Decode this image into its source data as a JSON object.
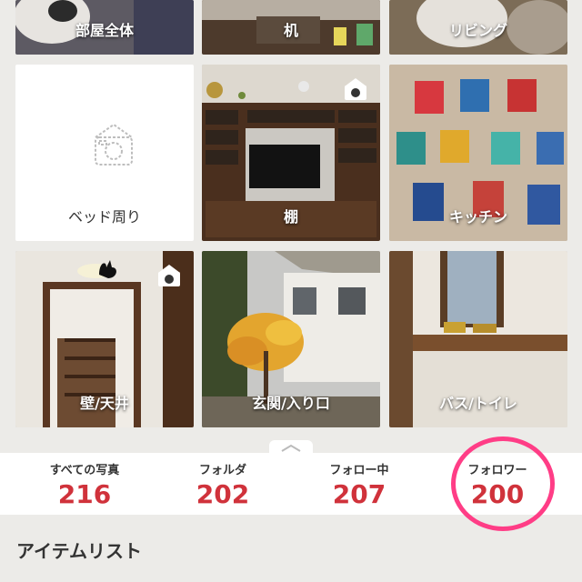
{
  "folders": {
    "row0": [
      {
        "label": "部屋全体"
      },
      {
        "label": "机"
      },
      {
        "label": "リビング"
      }
    ],
    "row1": [
      {
        "label": "ベッド周り"
      },
      {
        "label": "棚"
      },
      {
        "label": "キッチン"
      }
    ],
    "row2": [
      {
        "label": "壁/天井"
      },
      {
        "label": "玄関/入り口"
      },
      {
        "label": "バス/トイレ"
      }
    ]
  },
  "stats": [
    {
      "label": "すべての写真",
      "value": "216"
    },
    {
      "label": "フォルダ",
      "value": "202"
    },
    {
      "label": "フォロー中",
      "value": "207"
    },
    {
      "label": "フォロワー",
      "value": "200"
    }
  ],
  "section": {
    "title": "アイテムリスト"
  },
  "colors": {
    "accent": "#d0323b",
    "highlight_ring": "#ff3d86"
  }
}
